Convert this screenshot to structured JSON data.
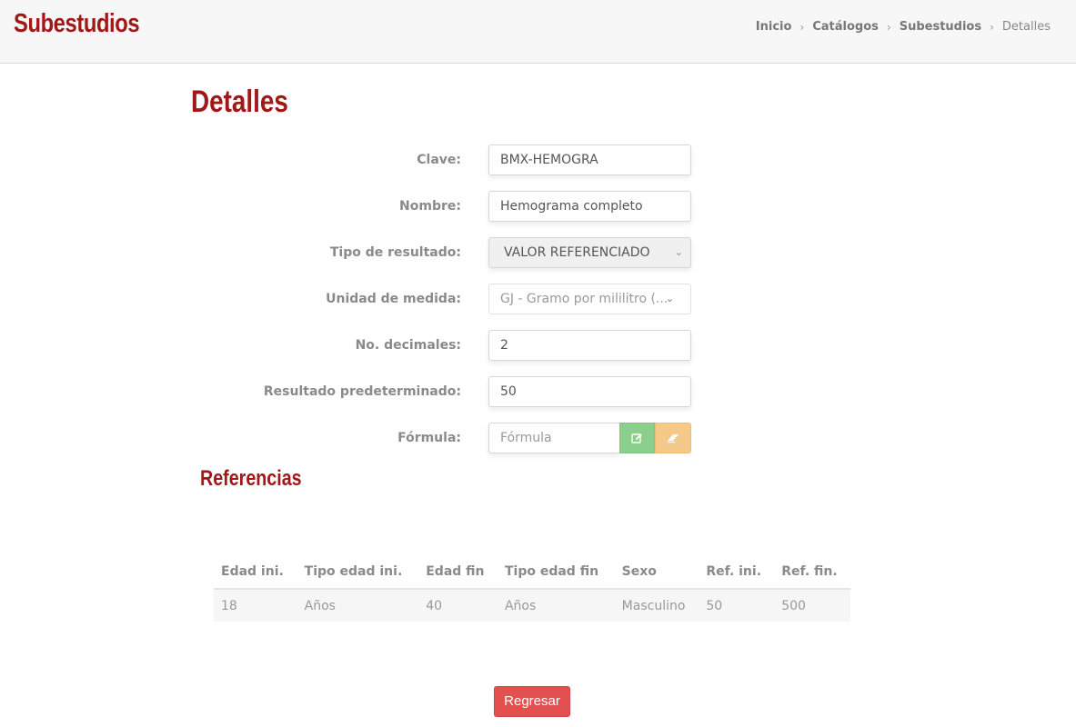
{
  "header": {
    "title": "Subestudios",
    "breadcrumb": [
      "Inicio",
      "Catálogos",
      "Subestudios",
      "Detalles"
    ]
  },
  "page_title": "Detalles",
  "form": {
    "clave": {
      "label": "Clave:",
      "value": "BMX-HEMOGRA"
    },
    "nombre": {
      "label": "Nombre:",
      "value": "Hemograma completo"
    },
    "tipo_resultado": {
      "label": "Tipo de resultado:",
      "value": "VALOR REFERENCIADO"
    },
    "unidad_medida": {
      "label": "Unidad de medida:",
      "value": "GJ - Gramo por mililitro (..."
    },
    "decimales": {
      "label": "No. decimales:",
      "value": "2"
    },
    "resultado_predeterminado": {
      "label": "Resultado predeterminado:",
      "value": "50"
    },
    "formula": {
      "label": "Fórmula:",
      "placeholder": "Fórmula"
    }
  },
  "references": {
    "title": "Referencias",
    "columns": [
      "Edad ini.",
      "Tipo edad ini.",
      "Edad fin",
      "Tipo edad fin",
      "Sexo",
      "Ref. ini.",
      "Ref. fin."
    ],
    "rows": [
      [
        "18",
        "Años",
        "40",
        "Años",
        "Masculino",
        "50",
        "500"
      ]
    ]
  },
  "back_label": "Regresar",
  "icons": {
    "edit": "edit-icon",
    "erase": "eraser-icon"
  },
  "colors": {
    "brand": "#a01818",
    "success": "#8ccf8c",
    "warning": "#f4c98a",
    "danger": "#e35050"
  }
}
